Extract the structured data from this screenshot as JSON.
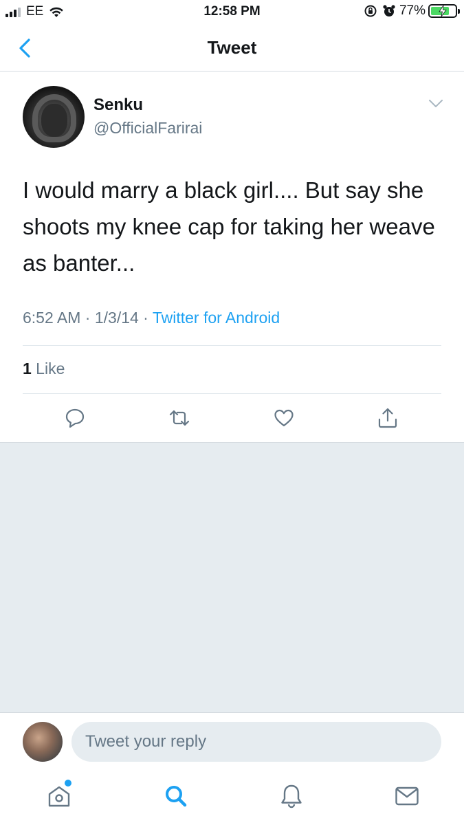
{
  "status_bar": {
    "carrier": "EE",
    "time": "12:58 PM",
    "battery_percent": "77%",
    "battery_level": 0.77
  },
  "nav": {
    "title": "Tweet",
    "back_icon": "chevron-left-icon"
  },
  "tweet": {
    "display_name": "Senku",
    "handle": "@OfficialFarirai",
    "text": "I would marry a black girl.... But say she shoots my knee cap for taking her weave as banter...",
    "time": "6:52 AM",
    "date": "1/3/14",
    "separator": " · ",
    "source": "Twitter for Android",
    "like_count": "1",
    "like_label": " Like",
    "actions": [
      "reply-icon",
      "retweet-icon",
      "like-icon",
      "share-icon"
    ]
  },
  "reply": {
    "placeholder": "Tweet your reply"
  },
  "tabs": [
    "home-icon",
    "search-icon",
    "notifications-icon",
    "messages-icon"
  ],
  "colors": {
    "accent": "#1da1f2",
    "secondary_text": "#657786",
    "background_gray": "#e6ecf0",
    "battery_green": "#4cd964"
  }
}
